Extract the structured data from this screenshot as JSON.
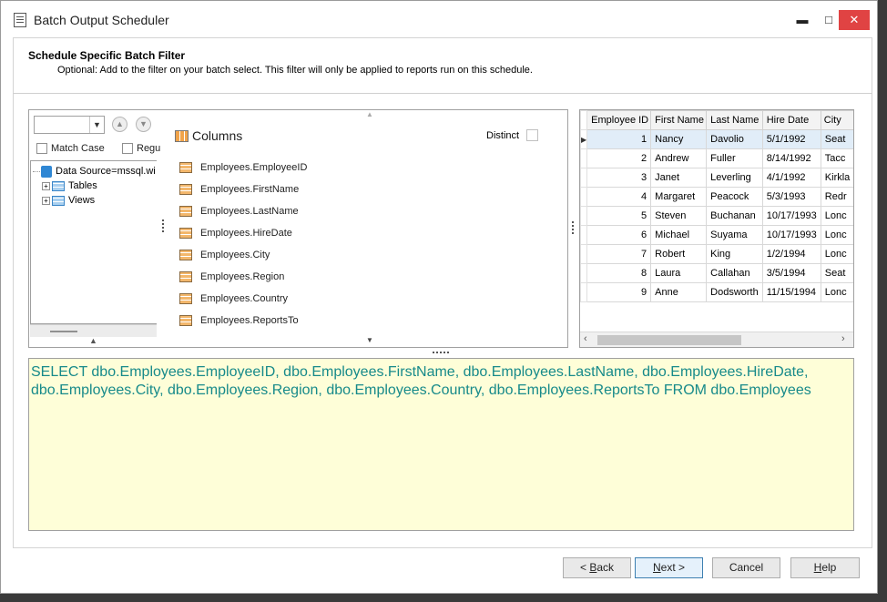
{
  "window": {
    "title": "Batch Output Scheduler",
    "title_icon": "document-icon",
    "controls": {
      "minimize": "▬",
      "maximize": "□",
      "close": "✕"
    }
  },
  "header": {
    "title": "Schedule Specific Batch Filter",
    "subtitle": "Optional: Add to the filter on your batch select. This filter will only be applied to reports run on this schedule."
  },
  "left_pane": {
    "combo_value": "",
    "match_case_label": "Match Case",
    "regex_label": "Regu",
    "tree": {
      "root": "Data Source=mssql.wi",
      "children": [
        "Tables",
        "Views"
      ]
    }
  },
  "columns_pane": {
    "title": "Columns",
    "distinct_label": "Distinct",
    "items": [
      "Employees.EmployeeID",
      "Employees.FirstName",
      "Employees.LastName",
      "Employees.HireDate",
      "Employees.City",
      "Employees.Region",
      "Employees.Country",
      "Employees.ReportsTo"
    ]
  },
  "grid": {
    "headers": [
      "Employee ID",
      "First Name",
      "Last Name",
      "Hire Date",
      "City"
    ],
    "rows": [
      [
        "1",
        "Nancy",
        "Davolio",
        "5/1/1992",
        "Seat"
      ],
      [
        "2",
        "Andrew",
        "Fuller",
        "8/14/1992",
        "Tacc"
      ],
      [
        "3",
        "Janet",
        "Leverling",
        "4/1/1992",
        "Kirkla"
      ],
      [
        "4",
        "Margaret",
        "Peacock",
        "5/3/1993",
        "Redr"
      ],
      [
        "5",
        "Steven",
        "Buchanan",
        "10/17/1993",
        "Lonc"
      ],
      [
        "6",
        "Michael",
        "Suyama",
        "10/17/1993",
        "Lonc"
      ],
      [
        "7",
        "Robert",
        "King",
        "1/2/1994",
        "Lonc"
      ],
      [
        "8",
        "Laura",
        "Callahan",
        "3/5/1994",
        "Seat"
      ],
      [
        "9",
        "Anne",
        "Dodsworth",
        "11/15/1994",
        "Lonc"
      ]
    ],
    "selected_row": 0
  },
  "sql": {
    "text": "SELECT dbo.Employees.EmployeeID, dbo.Employees.FirstName, dbo.Employees.LastName, dbo.Employees.HireDate, dbo.Employees.City, dbo.Employees.Region, dbo.Employees.Country, dbo.Employees.ReportsTo FROM dbo.Employees"
  },
  "buttons": {
    "back": {
      "prefix": "< ",
      "accel": "B",
      "rest": "ack"
    },
    "next": {
      "accel": "N",
      "rest": "ext >"
    },
    "cancel": "Cancel",
    "help": {
      "accel": "H",
      "rest": "elp"
    }
  }
}
